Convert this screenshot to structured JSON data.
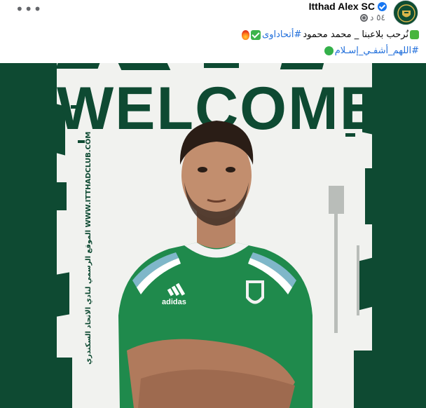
{
  "post": {
    "page_name": "Itthad Alex SC",
    "time": "٥٤ د",
    "line1_text": "نُرحب بلاعبنا _ محمد محمود",
    "line1_hashtag": "#أتحاداوى",
    "line2_hashtag": "#اللهم_أشفـي_إسـلام"
  },
  "poster": {
    "headline": "WELCOME",
    "side_text": "الموقع الرسمي لنادي الاتحاد السكندري WWW.ITTHADCLUB.COM",
    "jersey_brand": "adidas"
  },
  "colors": {
    "club_green": "#0e4a32",
    "jersey_green": "#1f8a4c",
    "link_blue": "#216fdb"
  },
  "icons": [
    "more-icon",
    "verified-icon",
    "globe-icon",
    "green-square-emoji",
    "check-emoji",
    "fire-emoji",
    "green-circle-emoji"
  ]
}
